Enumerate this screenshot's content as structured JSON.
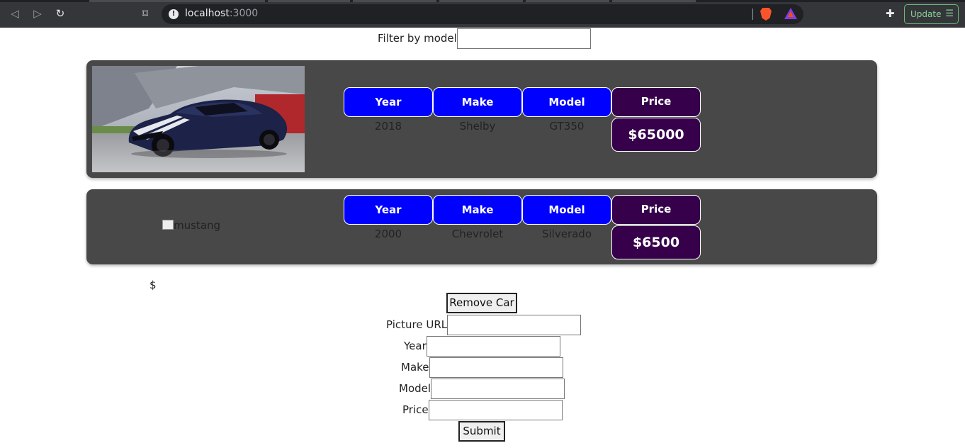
{
  "browser": {
    "url_host": "localhost",
    "url_port": ":3000",
    "update_label": "Update"
  },
  "filter": {
    "label": "Filter by model",
    "value": ""
  },
  "columns": {
    "year": "Year",
    "make": "Make",
    "model": "Model",
    "price": "Price"
  },
  "cars": [
    {
      "image_alt": "",
      "year": "2018",
      "make": "Shelby",
      "model": "GT350",
      "price": "$65000"
    },
    {
      "image_alt": "mustang",
      "year": "2000",
      "make": "Chevrolet",
      "model": "Silverado",
      "price": "$6500"
    }
  ],
  "stray_text": "$",
  "remove_button": "Remove Car",
  "form": {
    "picture_url_label": "Picture URL",
    "year_label": "Year",
    "make_label": "Make",
    "model_label": "Model",
    "price_label": "Price",
    "submit_label": "Submit"
  }
}
